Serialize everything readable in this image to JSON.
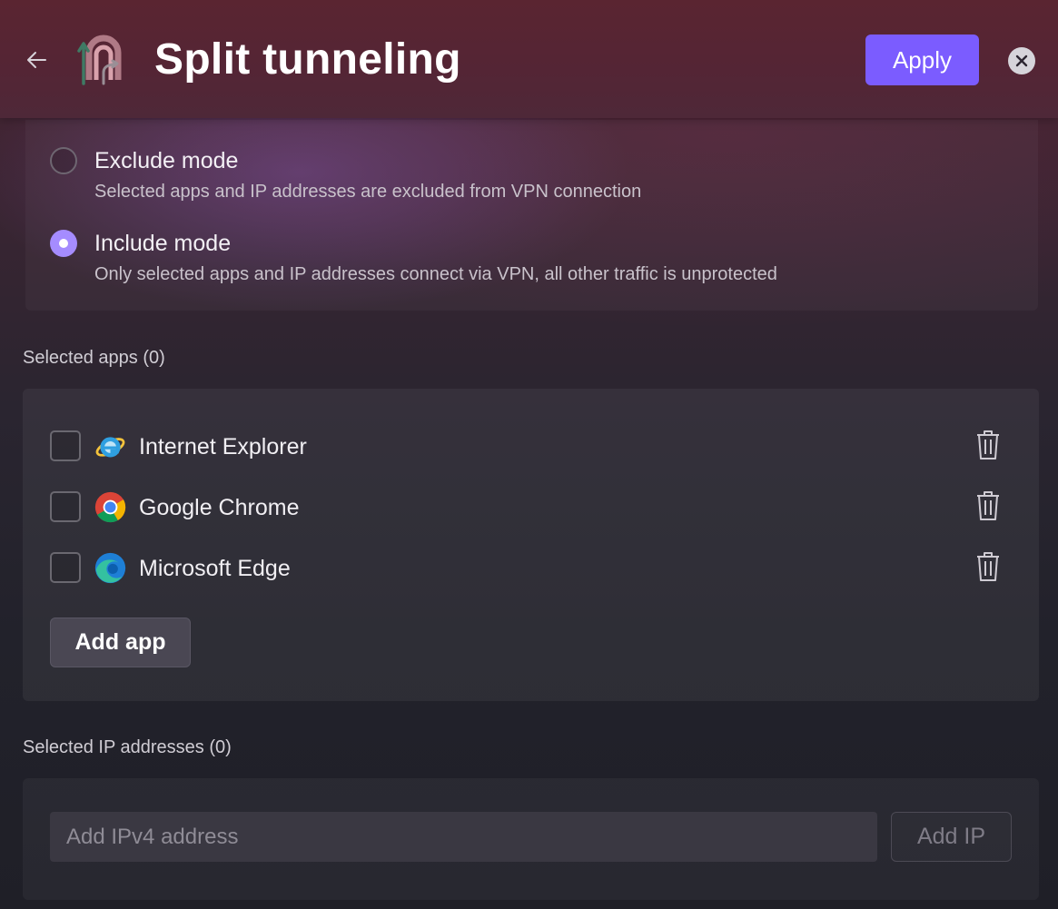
{
  "header": {
    "title": "Split tunneling",
    "apply_label": "Apply",
    "back_icon": "arrow-left-icon",
    "close_icon": "close-icon",
    "logo_icon": "split-tunnel-logo"
  },
  "modes": [
    {
      "label": "Exclude mode",
      "description": "Selected apps and IP addresses are excluded from VPN connection",
      "selected": false
    },
    {
      "label": "Include mode",
      "description": "Only selected apps and IP addresses connect via VPN, all other traffic is unprotected",
      "selected": true
    }
  ],
  "apps_section": {
    "label": "Selected apps (0)",
    "apps": [
      {
        "name": "Internet Explorer",
        "icon": "internet-explorer-icon",
        "checked": false
      },
      {
        "name": "Google Chrome",
        "icon": "chrome-icon",
        "checked": false
      },
      {
        "name": "Microsoft Edge",
        "icon": "edge-icon",
        "checked": false
      }
    ],
    "add_label": "Add app"
  },
  "ip_section": {
    "label": "Selected IP addresses (0)",
    "placeholder": "Add IPv4 address",
    "value": "",
    "add_label": "Add IP"
  },
  "colors": {
    "accent": "#7b5cff",
    "radio_selected": "#a58cff",
    "header_bg": "#5a2531"
  }
}
